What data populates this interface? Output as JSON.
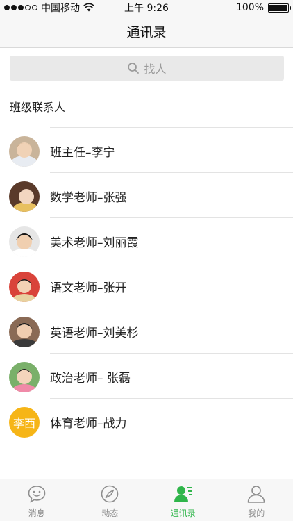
{
  "status_bar": {
    "carrier": "中国移动",
    "time": "上午 9:26",
    "battery": "100%"
  },
  "nav": {
    "title": "通讯录"
  },
  "search": {
    "placeholder": "找人"
  },
  "section": {
    "title": "班级联系人"
  },
  "contacts": [
    {
      "name": "班主任–李宁",
      "avatar": "photo-1"
    },
    {
      "name": "数学老师–张强",
      "avatar": "photo-2"
    },
    {
      "name": "美术老师–刘丽霞",
      "avatar": "photo-3"
    },
    {
      "name": "语文老师–张开",
      "avatar": "photo-4"
    },
    {
      "name": "英语老师–刘美杉",
      "avatar": "photo-5"
    },
    {
      "name": "政治老师– 张磊",
      "avatar": "photo-6"
    },
    {
      "name": "体育老师–战力",
      "avatar_text": "李西",
      "avatar_color": "#f6b517"
    }
  ],
  "tabs": [
    {
      "label": "消息",
      "icon": "chat-bubble-icon",
      "active": false
    },
    {
      "label": "动态",
      "icon": "compass-icon",
      "active": false
    },
    {
      "label": "通讯录",
      "icon": "contacts-icon",
      "active": true
    },
    {
      "label": "我的",
      "icon": "profile-icon",
      "active": false
    }
  ],
  "colors": {
    "accent": "#2fb54a",
    "inactive": "#8e8e8e",
    "avatar_badge": "#f6b517"
  }
}
